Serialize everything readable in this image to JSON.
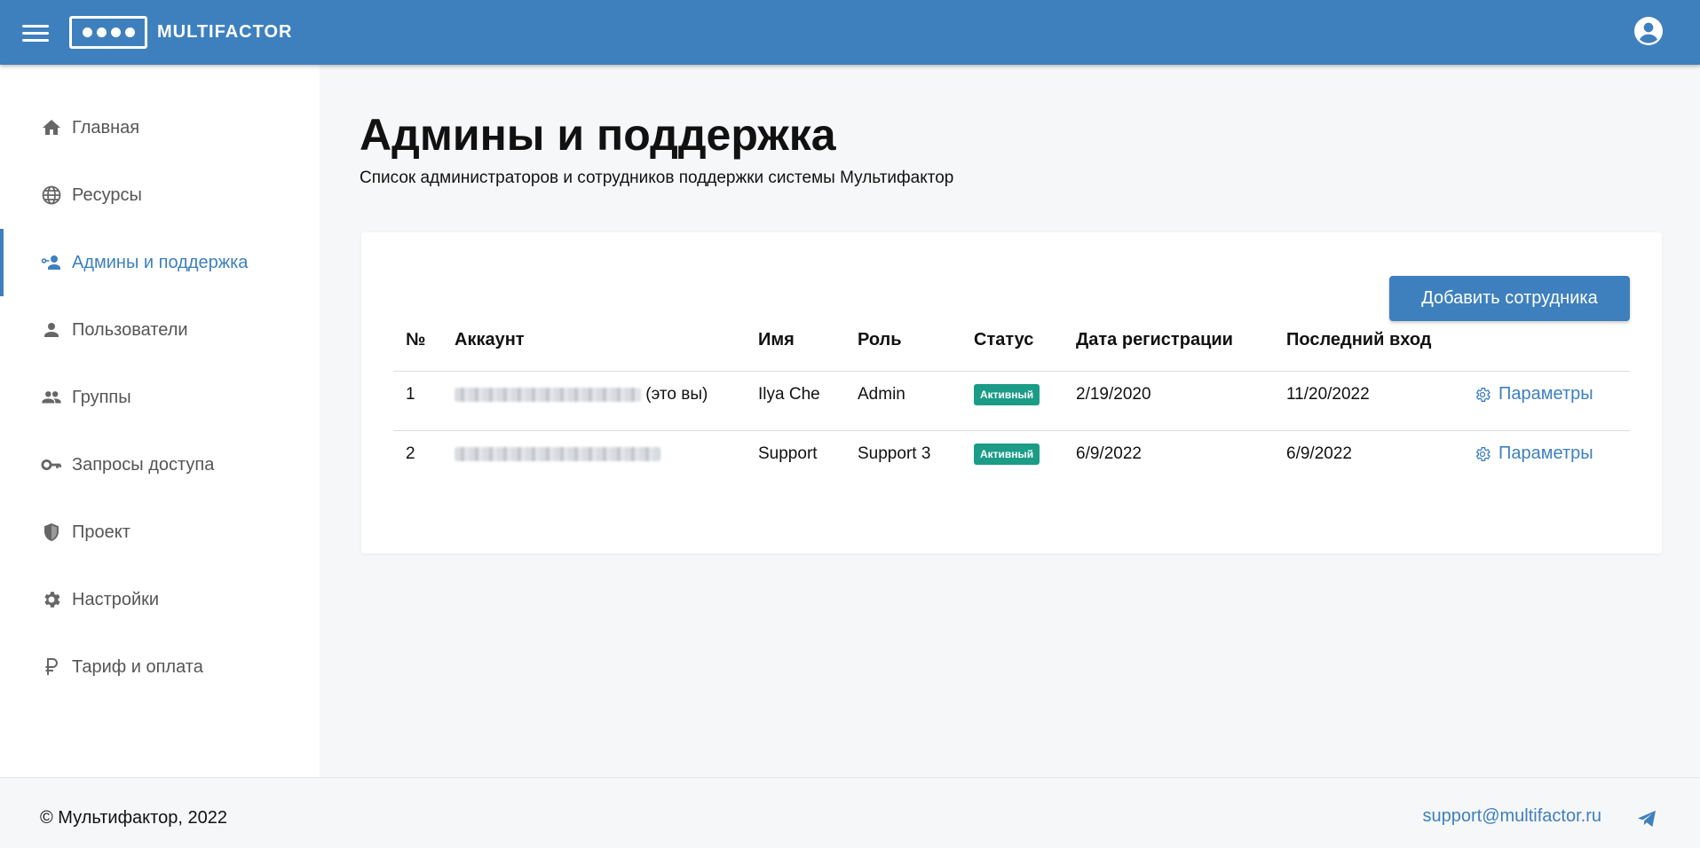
{
  "header": {
    "logo_text": "MULTIFACTOR"
  },
  "colors": {
    "primary": "#3e80bd",
    "badge_active": "#1a9c87"
  },
  "sidebar": {
    "items": [
      {
        "label": "Главная",
        "icon": "home-icon"
      },
      {
        "label": "Ресурсы",
        "icon": "globe-icon"
      },
      {
        "label": "Админы и поддержка",
        "icon": "admin-user-icon",
        "active": true
      },
      {
        "label": "Пользователи",
        "icon": "person-icon"
      },
      {
        "label": "Группы",
        "icon": "people-icon"
      },
      {
        "label": "Запросы доступа",
        "icon": "key-icon"
      },
      {
        "label": "Проект",
        "icon": "shield-icon"
      },
      {
        "label": "Настройки",
        "icon": "gear-icon"
      },
      {
        "label": "Тариф и оплата",
        "icon": "ruble-icon"
      }
    ]
  },
  "main": {
    "title": "Админы и поддержка",
    "subtitle": "Список администраторов и сотрудников поддержки системы Мультифактор",
    "add_button": "Добавить сотрудника",
    "table": {
      "headers": [
        "№",
        "Аккаунт",
        "Имя",
        "Роль",
        "Статус",
        "Дата регистрации",
        "Последний вход"
      ],
      "rows": [
        {
          "num": "1",
          "account_suffix": "(это вы)",
          "name": "Ilya Che",
          "role": "Admin",
          "status": "Активный",
          "registered": "2/19/2020",
          "last_login": "11/20/2022",
          "action": "Параметры"
        },
        {
          "num": "2",
          "account_suffix": "",
          "name": "Support",
          "role": "Support 3",
          "status": "Активный",
          "registered": "6/9/2022",
          "last_login": "6/9/2022",
          "action": "Параметры"
        }
      ]
    }
  },
  "footer": {
    "copyright": "© Мультифактор, 2022",
    "email": "support@multifactor.ru"
  }
}
